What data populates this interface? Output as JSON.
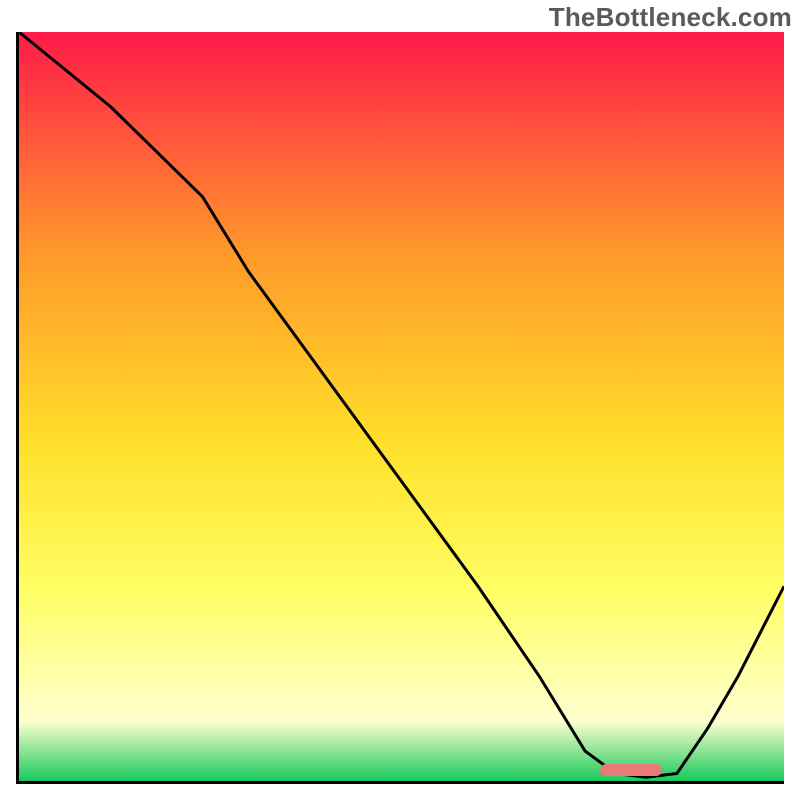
{
  "watermark": "TheBottleneck.com",
  "colors": {
    "gradient_top": "#ff1a4a",
    "gradient_mid_upper": "#ff9a2a",
    "gradient_mid": "#ffe02a",
    "gradient_mid_lower": "#ffff66",
    "gradient_pale": "#ffffcf",
    "gradient_bottom": "#18c95b",
    "curve": "#000000",
    "marker": "#e87b78",
    "axis": "#000000"
  },
  "chart_data": {
    "type": "line",
    "title": "",
    "xlabel": "",
    "ylabel": "",
    "xlim": [
      0,
      100
    ],
    "ylim": [
      0,
      100
    ],
    "series": [
      {
        "name": "bottleneck-curve",
        "x": [
          0,
          12,
          20,
          24,
          30,
          40,
          50,
          60,
          68,
          74,
          78,
          82,
          86,
          90,
          94,
          100
        ],
        "values": [
          100,
          90,
          82,
          78,
          68,
          54,
          40,
          26,
          14,
          4,
          1,
          0.5,
          1,
          7,
          14,
          26
        ]
      }
    ],
    "annotations": [
      {
        "name": "optimal-range-marker",
        "x_start": 76,
        "x_end": 84,
        "y": 1.5
      }
    ],
    "legend": [],
    "grid": false
  }
}
